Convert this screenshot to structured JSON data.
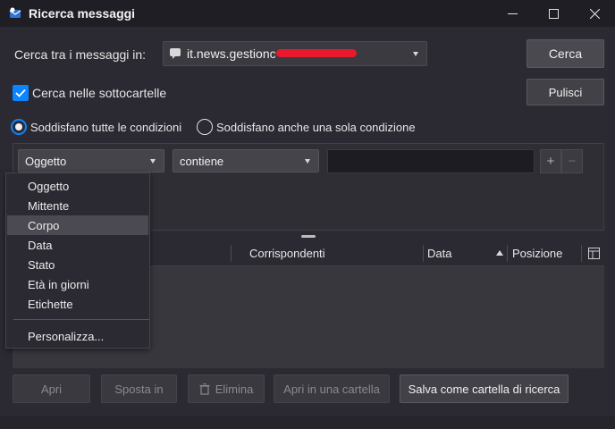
{
  "window": {
    "title": "Ricerca messaggi",
    "icon": "thunderbird-icon",
    "controls": [
      "minimize-icon",
      "maximize-icon",
      "close-icon"
    ]
  },
  "search_in": {
    "label": "Cerca tra i messaggi in:",
    "folder_value": "it.news.gestionc",
    "folder_icon": "newsgroup-icon"
  },
  "subfolders": {
    "label": "Cerca nelle sottocartelle",
    "checked": true
  },
  "buttons": {
    "search": "Cerca",
    "clear": "Pulisci"
  },
  "match": {
    "all": "Soddisfano tutte le condizioni",
    "any": "Soddisfano anche una sola condizione",
    "selected": "all"
  },
  "condition": {
    "field": "Oggetto",
    "operator": "contiene",
    "value": "",
    "add": "+",
    "remove": "−"
  },
  "field_menu": {
    "items": [
      "Oggetto",
      "Mittente",
      "Corpo",
      "Data",
      "Stato",
      "Età in giorni",
      "Etichette"
    ],
    "highlighted": "Corpo",
    "customize": "Personalizza..."
  },
  "results": {
    "columns": [
      "Corrispondenti",
      "Data",
      "Posizione"
    ],
    "sort_column": "Data",
    "sort_direction": "ascending",
    "column_picker_icon": "column-picker-icon"
  },
  "actions": {
    "open": "Apri",
    "move_to": "Sposta in",
    "delete": "Elimina",
    "open_in_folder": "Apri in una cartella",
    "save_as_search_folder": "Salva come cartella di ricerca"
  },
  "colors": {
    "accent": "#0a84ff",
    "background": "#2b2a33",
    "redaction": "#e8192c"
  }
}
